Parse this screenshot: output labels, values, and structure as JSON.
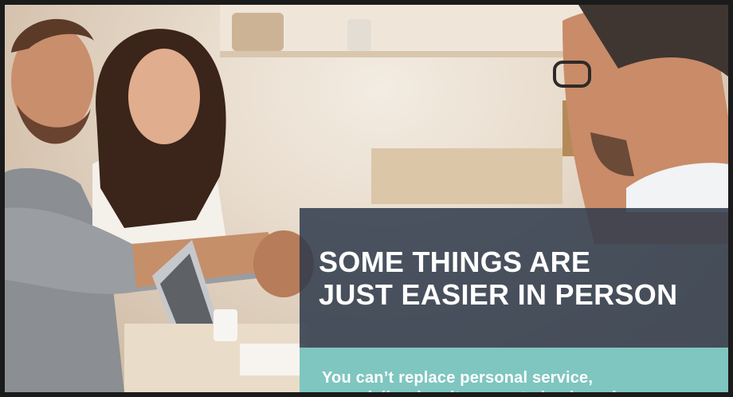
{
  "headline": {
    "line1": "SOME THINGS ARE",
    "line2": "JUST EASIER IN PERSON"
  },
  "subtext": {
    "line1": "You can’t replace personal service,",
    "line2": "especially when it comes to buying a home."
  },
  "colors": {
    "headline_panel": "#2e3a4c",
    "subtext_panel": "#7fc6c0",
    "text": "#ffffff"
  }
}
